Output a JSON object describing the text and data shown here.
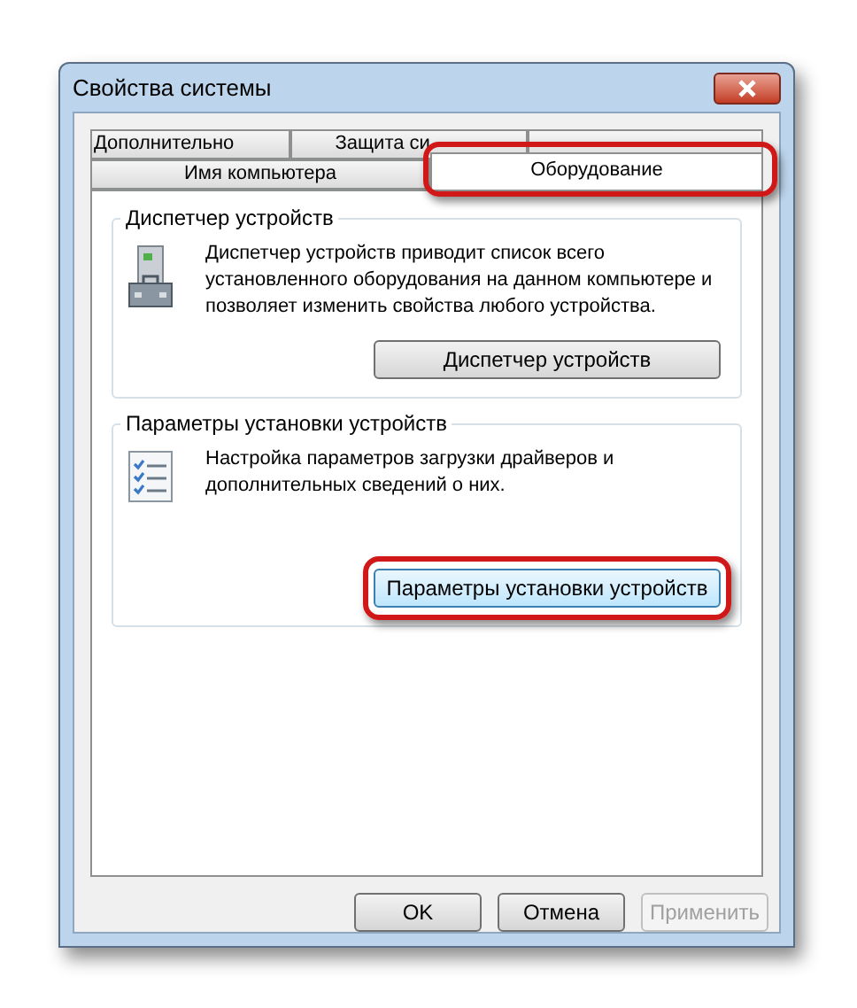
{
  "window": {
    "title": "Свойства системы"
  },
  "tab_rows": [
    {
      "tabs": [
        {
          "label": "Дополнительно",
          "selected": false,
          "highlighted": false
        },
        {
          "label": "Защита си",
          "selected": false,
          "highlighted": false
        },
        {
          "selected": false,
          "highlighted": false
        }
      ]
    },
    {
      "tabs": [
        {
          "label": "Имя компьютера",
          "selected": false,
          "highlighted": false
        },
        {
          "label": "Оборудование",
          "selected": true,
          "highlighted": true
        }
      ]
    }
  ],
  "groups": [
    {
      "title": "Диспетчер устройств",
      "kind": "toolbox",
      "text": "Диспетчер устройств приводит список всего установленного оборудования на данном компьютере и позволяет изменить свойства любого устройства.",
      "button": {
        "label": "Диспетчер устройств",
        "highlighted": false
      }
    },
    {
      "title": "Параметры установки устройств",
      "kind": "checklist",
      "text": "Настройка параметров загрузки драйверов и дополнительных сведений о них.",
      "button": {
        "label": "Параметры установки устройств",
        "highlighted": true
      }
    }
  ],
  "buttons": [
    {
      "label": "OK",
      "disabled": false
    },
    {
      "label": "Отмена",
      "disabled": false
    },
    {
      "label": "Применить",
      "disabled": true
    }
  ]
}
